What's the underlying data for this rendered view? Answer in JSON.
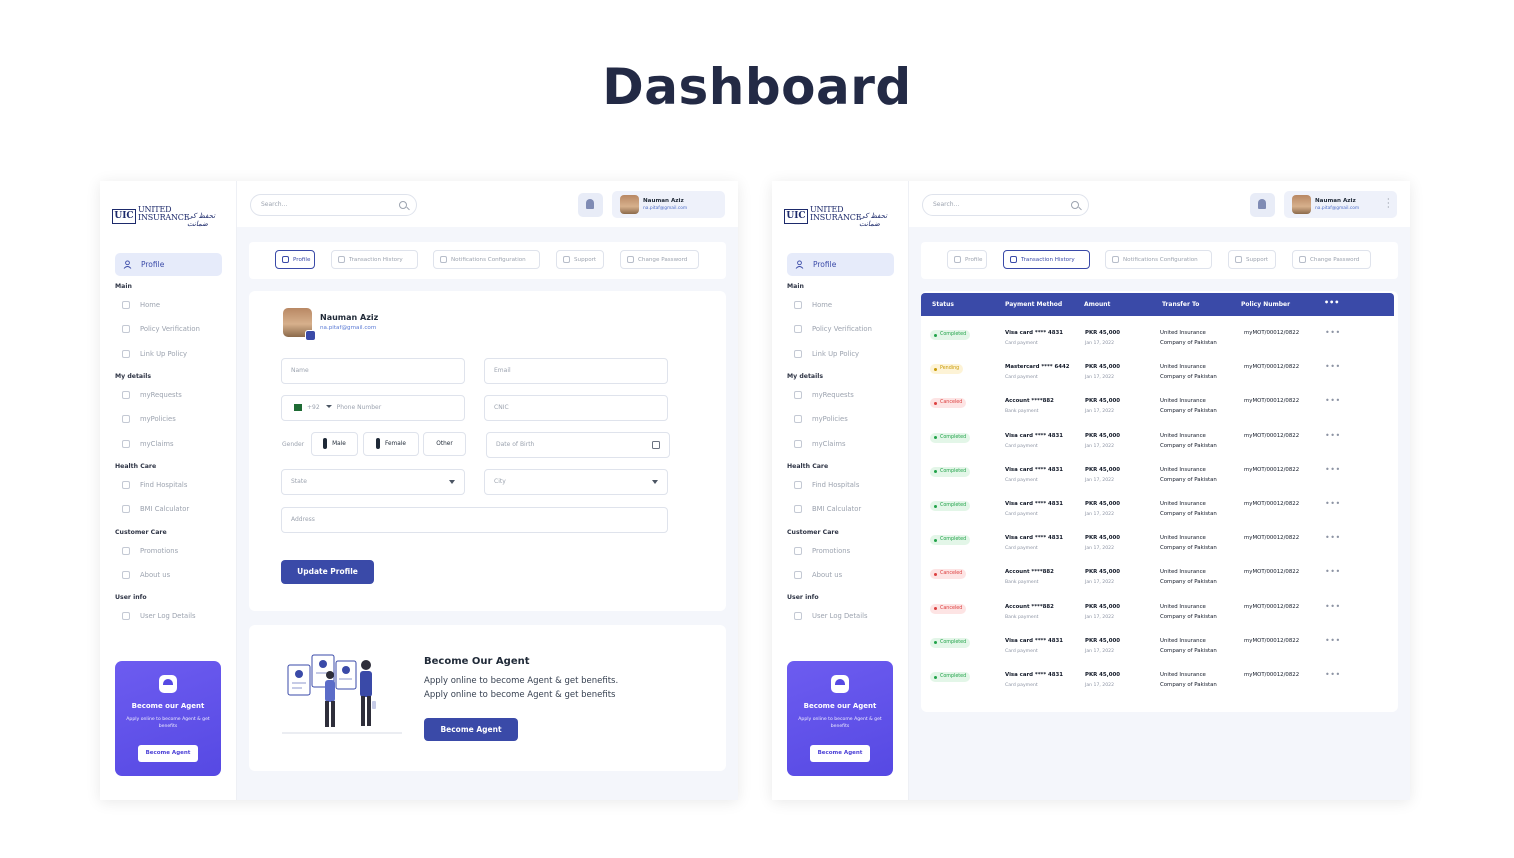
{
  "page": {
    "title": "Dashboard"
  },
  "brand": {
    "mark": "UIC",
    "name_line1": "UNITED",
    "name_line2": "INSURANCE",
    "tagline": "تحفظ کی ضمانت"
  },
  "sidebar": {
    "profile_label": "Profile",
    "sections": [
      {
        "label": "Main",
        "items": [
          "Home",
          "Policy Verification",
          "Link Up Policy"
        ]
      },
      {
        "label": "My details",
        "items": [
          "myRequests",
          "myPolicies",
          "myClaims"
        ]
      },
      {
        "label": "Health Care",
        "items": [
          "Find Hospitals",
          "BMI Calculator"
        ]
      },
      {
        "label": "Customer Care",
        "items": [
          "Promotions",
          "About us"
        ]
      },
      {
        "label": "User info",
        "items": [
          "User Log Details"
        ]
      }
    ],
    "agent_card": {
      "title": "Become our Agent",
      "description": "Apply online to become Agent & get benefits",
      "button": "Become Agent"
    }
  },
  "topbar": {
    "search_placeholder": "Search...",
    "user_name": "Nauman Aziz",
    "user_email": "na.pitaf@gmail.com"
  },
  "tabs": [
    "Profile",
    "Transaction History",
    "Notifications Configuration",
    "Support",
    "Change Password"
  ],
  "profile_form": {
    "name": "Nauman Aziz",
    "email": "na.pitaf@gmail.com",
    "fields": {
      "name_placeholder": "Name",
      "email_placeholder": "Email",
      "country_code": "+92",
      "phone_placeholder": "Phone Number",
      "cnic_placeholder": "CNIC",
      "gender_label": "Gender",
      "gender_options": [
        "Male",
        "Female",
        "Other"
      ],
      "dob_placeholder": "Date of Birth",
      "state_placeholder": "State",
      "city_placeholder": "City",
      "address_placeholder": "Address"
    },
    "submit_label": "Update Profile"
  },
  "agent_banner": {
    "title": "Become Our Agent",
    "line1": "Apply online to become Agent & get benefits.",
    "line2": "Apply online to become Agent & get benefits",
    "button": "Become Agent"
  },
  "transactions": {
    "columns": [
      "Status",
      "Payment Method",
      "Amount",
      "Transfer To",
      "Policy Number",
      "•••"
    ],
    "rows": [
      {
        "status": "Completed",
        "status_kind": "completed",
        "method": "Visa card **** 4831",
        "method_type": "Card payment",
        "amount": "PKR 45,000",
        "date": "Jan 17, 2022",
        "to1": "United Insurance",
        "to2": "Company of Pakistan",
        "policy": "myMOT/00012/0822"
      },
      {
        "status": "Pending",
        "status_kind": "pending",
        "method": "Mastercard **** 6442",
        "method_type": "Card payment",
        "amount": "PKR 45,000",
        "date": "Jan 17, 2022",
        "to1": "United Insurance",
        "to2": "Company of Pakistan",
        "policy": "myMOT/00012/0822"
      },
      {
        "status": "Canceled",
        "status_kind": "canceled",
        "method": "Account ****882",
        "method_type": "Bank payment",
        "amount": "PKR 45,000",
        "date": "Jan 17, 2022",
        "to1": "United Insurance",
        "to2": "Company of Pakistan",
        "policy": "myMOT/00012/0822"
      },
      {
        "status": "Completed",
        "status_kind": "completed",
        "method": "Visa card **** 4831",
        "method_type": "Card payment",
        "amount": "PKR 45,000",
        "date": "Jan 17, 2022",
        "to1": "United Insurance",
        "to2": "Company of Pakistan",
        "policy": "myMOT/00012/0822"
      },
      {
        "status": "Completed",
        "status_kind": "completed",
        "method": "Visa card **** 4831",
        "method_type": "Card payment",
        "amount": "PKR 45,000",
        "date": "Jan 17, 2022",
        "to1": "United Insurance",
        "to2": "Company of Pakistan",
        "policy": "myMOT/00012/0822"
      },
      {
        "status": "Completed",
        "status_kind": "completed",
        "method": "Visa card **** 4831",
        "method_type": "Card payment",
        "amount": "PKR 45,000",
        "date": "Jan 17, 2022",
        "to1": "United Insurance",
        "to2": "Company of Pakistan",
        "policy": "myMOT/00012/0822"
      },
      {
        "status": "Completed",
        "status_kind": "completed",
        "method": "Visa card **** 4831",
        "method_type": "Card payment",
        "amount": "PKR 45,000",
        "date": "Jan 17, 2022",
        "to1": "United Insurance",
        "to2": "Company of Pakistan",
        "policy": "myMOT/00012/0822"
      },
      {
        "status": "Canceled",
        "status_kind": "canceled",
        "method": "Account ****882",
        "method_type": "Bank payment",
        "amount": "PKR 45,000",
        "date": "Jan 17, 2022",
        "to1": "United Insurance",
        "to2": "Company of Pakistan",
        "policy": "myMOT/00012/0822"
      },
      {
        "status": "Canceled",
        "status_kind": "canceled",
        "method": "Account ****882",
        "method_type": "Bank payment",
        "amount": "PKR 45,000",
        "date": "Jan 17, 2022",
        "to1": "United Insurance",
        "to2": "Company of Pakistan",
        "policy": "myMOT/00012/0822"
      },
      {
        "status": "Completed",
        "status_kind": "completed",
        "method": "Visa card **** 4831",
        "method_type": "Card payment",
        "amount": "PKR 45,000",
        "date": "Jan 17, 2022",
        "to1": "United Insurance",
        "to2": "Company of Pakistan",
        "policy": "myMOT/00012/0822"
      },
      {
        "status": "Completed",
        "status_kind": "completed",
        "method": "Visa card **** 4831",
        "method_type": "Card payment",
        "amount": "PKR 45,000",
        "date": "Jan 17, 2022",
        "to1": "United Insurance",
        "to2": "Company of Pakistan",
        "policy": "myMOT/00012/0822"
      }
    ]
  },
  "colors": {
    "primary": "#3a4aa8",
    "agent_card": "#5649e3",
    "completed": "#22a34a",
    "pending": "#c99a06",
    "canceled": "#dc4040"
  },
  "icons": {
    "search": "search-icon",
    "bell": "bell-icon",
    "camera": "camera-icon",
    "calendar": "calendar-icon",
    "chevron": "chevron-down-icon",
    "umbrella": "umbrella-icon",
    "more": "more-dots-icon"
  }
}
